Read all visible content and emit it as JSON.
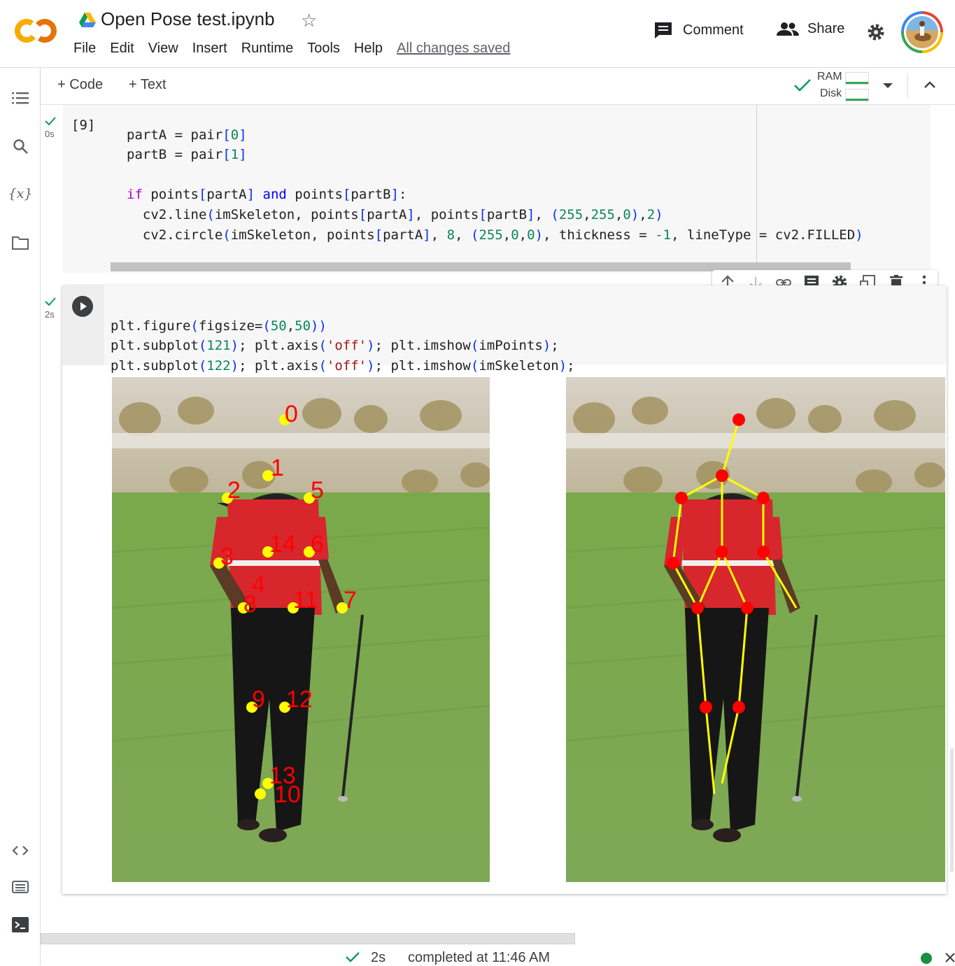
{
  "header": {
    "title": "Open Pose test.ipynb",
    "logo_text": "CO",
    "menu": [
      "File",
      "Edit",
      "View",
      "Insert",
      "Runtime",
      "Tools",
      "Help"
    ],
    "save_status": "All changes saved",
    "comment_label": "Comment",
    "share_label": "Share"
  },
  "toolbar": {
    "add_code_label": "Code",
    "add_text_label": "Text",
    "ram_label": "RAM",
    "disk_label": "Disk"
  },
  "sidebar": {
    "icons": [
      "table-of-contents-icon",
      "search-icon",
      "variables-icon",
      "files-icon",
      "code-snippets-icon",
      "command-palette-icon",
      "terminal-icon"
    ]
  },
  "cells": [
    {
      "exec_label": "[9]",
      "status_time": "0s",
      "lines": [
        "partA = pair[0]",
        "partB = pair[1]",
        "",
        "if points[partA] and points[partB]:",
        "  cv2.line(imSkeleton, points[partA], points[partB], (255,255,0),2)",
        "  cv2.circle(imSkeleton, points[partA], 8, (255,0,0), thickness = -1, lineType = cv2.FILLED)"
      ]
    },
    {
      "status_time": "2s",
      "lines": [
        "plt.figure(figsize=(50,50))",
        "plt.subplot(121); plt.axis('off'); plt.imshow(imPoints);",
        "plt.subplot(122); plt.axis('off'); plt.imshow(imSkeleton);"
      ]
    }
  ],
  "output": {
    "keypoint_labels": [
      "0",
      "1",
      "2",
      "3",
      "4",
      "5",
      "6",
      "7",
      "8",
      "9",
      "10",
      "11",
      "12",
      "13",
      "14"
    ],
    "point_color": "#ffff00",
    "label_color": "#ff0000"
  },
  "statusbar": {
    "duration": "2s",
    "completed_text": "completed at 11:46 AM"
  },
  "colors": {
    "accent_orange": "#f9ab00",
    "check_green": "#0f9d58",
    "status_dot": "#1e8e3e"
  }
}
